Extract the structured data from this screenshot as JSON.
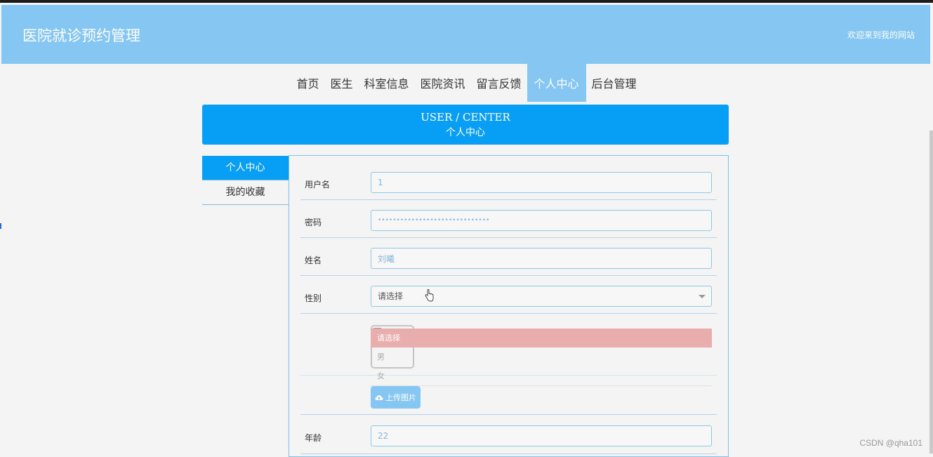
{
  "header": {
    "site_title": "医院就诊预约管理",
    "welcome": "欢迎来到我的网站"
  },
  "nav": {
    "items": [
      {
        "label": "首页"
      },
      {
        "label": "医生"
      },
      {
        "label": "科室信息"
      },
      {
        "label": "医院资讯"
      },
      {
        "label": "留言反馈"
      },
      {
        "label": "个人中心",
        "active": true
      },
      {
        "label": "后台管理"
      }
    ]
  },
  "banner": {
    "title_en": "USER / CENTER",
    "title_cn": "个人中心"
  },
  "sidebar": {
    "items": [
      {
        "label": "个人中心",
        "active": true
      },
      {
        "label": "我的收藏"
      }
    ]
  },
  "form": {
    "username": {
      "label": "用户名",
      "value": "1"
    },
    "password": {
      "label": "密码",
      "value": "••••••••••••••••••••••••••••••"
    },
    "name": {
      "label": "姓名",
      "value": "刘曦"
    },
    "gender": {
      "label": "性别",
      "value": "请选择",
      "options": [
        "请选择",
        "男",
        "女"
      ]
    },
    "upload": {
      "label": "上传图片"
    },
    "age": {
      "label": "年龄",
      "value": "22"
    }
  },
  "watermark": "CSDN @qha101",
  "colors": {
    "header_bg": "#85c6f3",
    "primary": "#079ef5",
    "selected_option": "#e9adae"
  }
}
